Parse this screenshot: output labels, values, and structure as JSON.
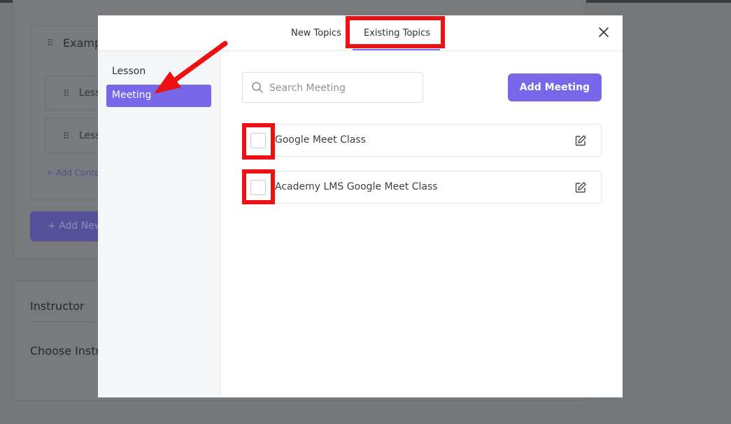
{
  "background": {
    "section_title": "Examp",
    "lesson_rows": [
      "Less",
      "Less"
    ],
    "add_content": "+ Add Conte",
    "add_new": "+ Add New",
    "instructor_label": "Instructor",
    "choose_instructor": "Choose Instru"
  },
  "modal": {
    "tabs": [
      {
        "label": "New Topics",
        "active": false
      },
      {
        "label": "Existing Topics",
        "active": true
      }
    ],
    "close_icon": "close-icon",
    "sidebar": {
      "items": [
        {
          "label": "Lesson",
          "active": false
        },
        {
          "label": "Meeting",
          "active": true
        }
      ]
    },
    "search": {
      "placeholder": "Search Meeting",
      "value": "",
      "icon": "search-icon"
    },
    "add_meeting_label": "Add Meeting",
    "meetings": [
      {
        "title": "Google Meet Class",
        "checked": false,
        "icon": "edit-icon"
      },
      {
        "title": "Academy LMS Google Meet Class",
        "checked": false,
        "icon": "edit-icon"
      }
    ]
  },
  "colors": {
    "accent": "#7867e8",
    "annotation": "#ee1111",
    "overlay": "#75787b"
  }
}
